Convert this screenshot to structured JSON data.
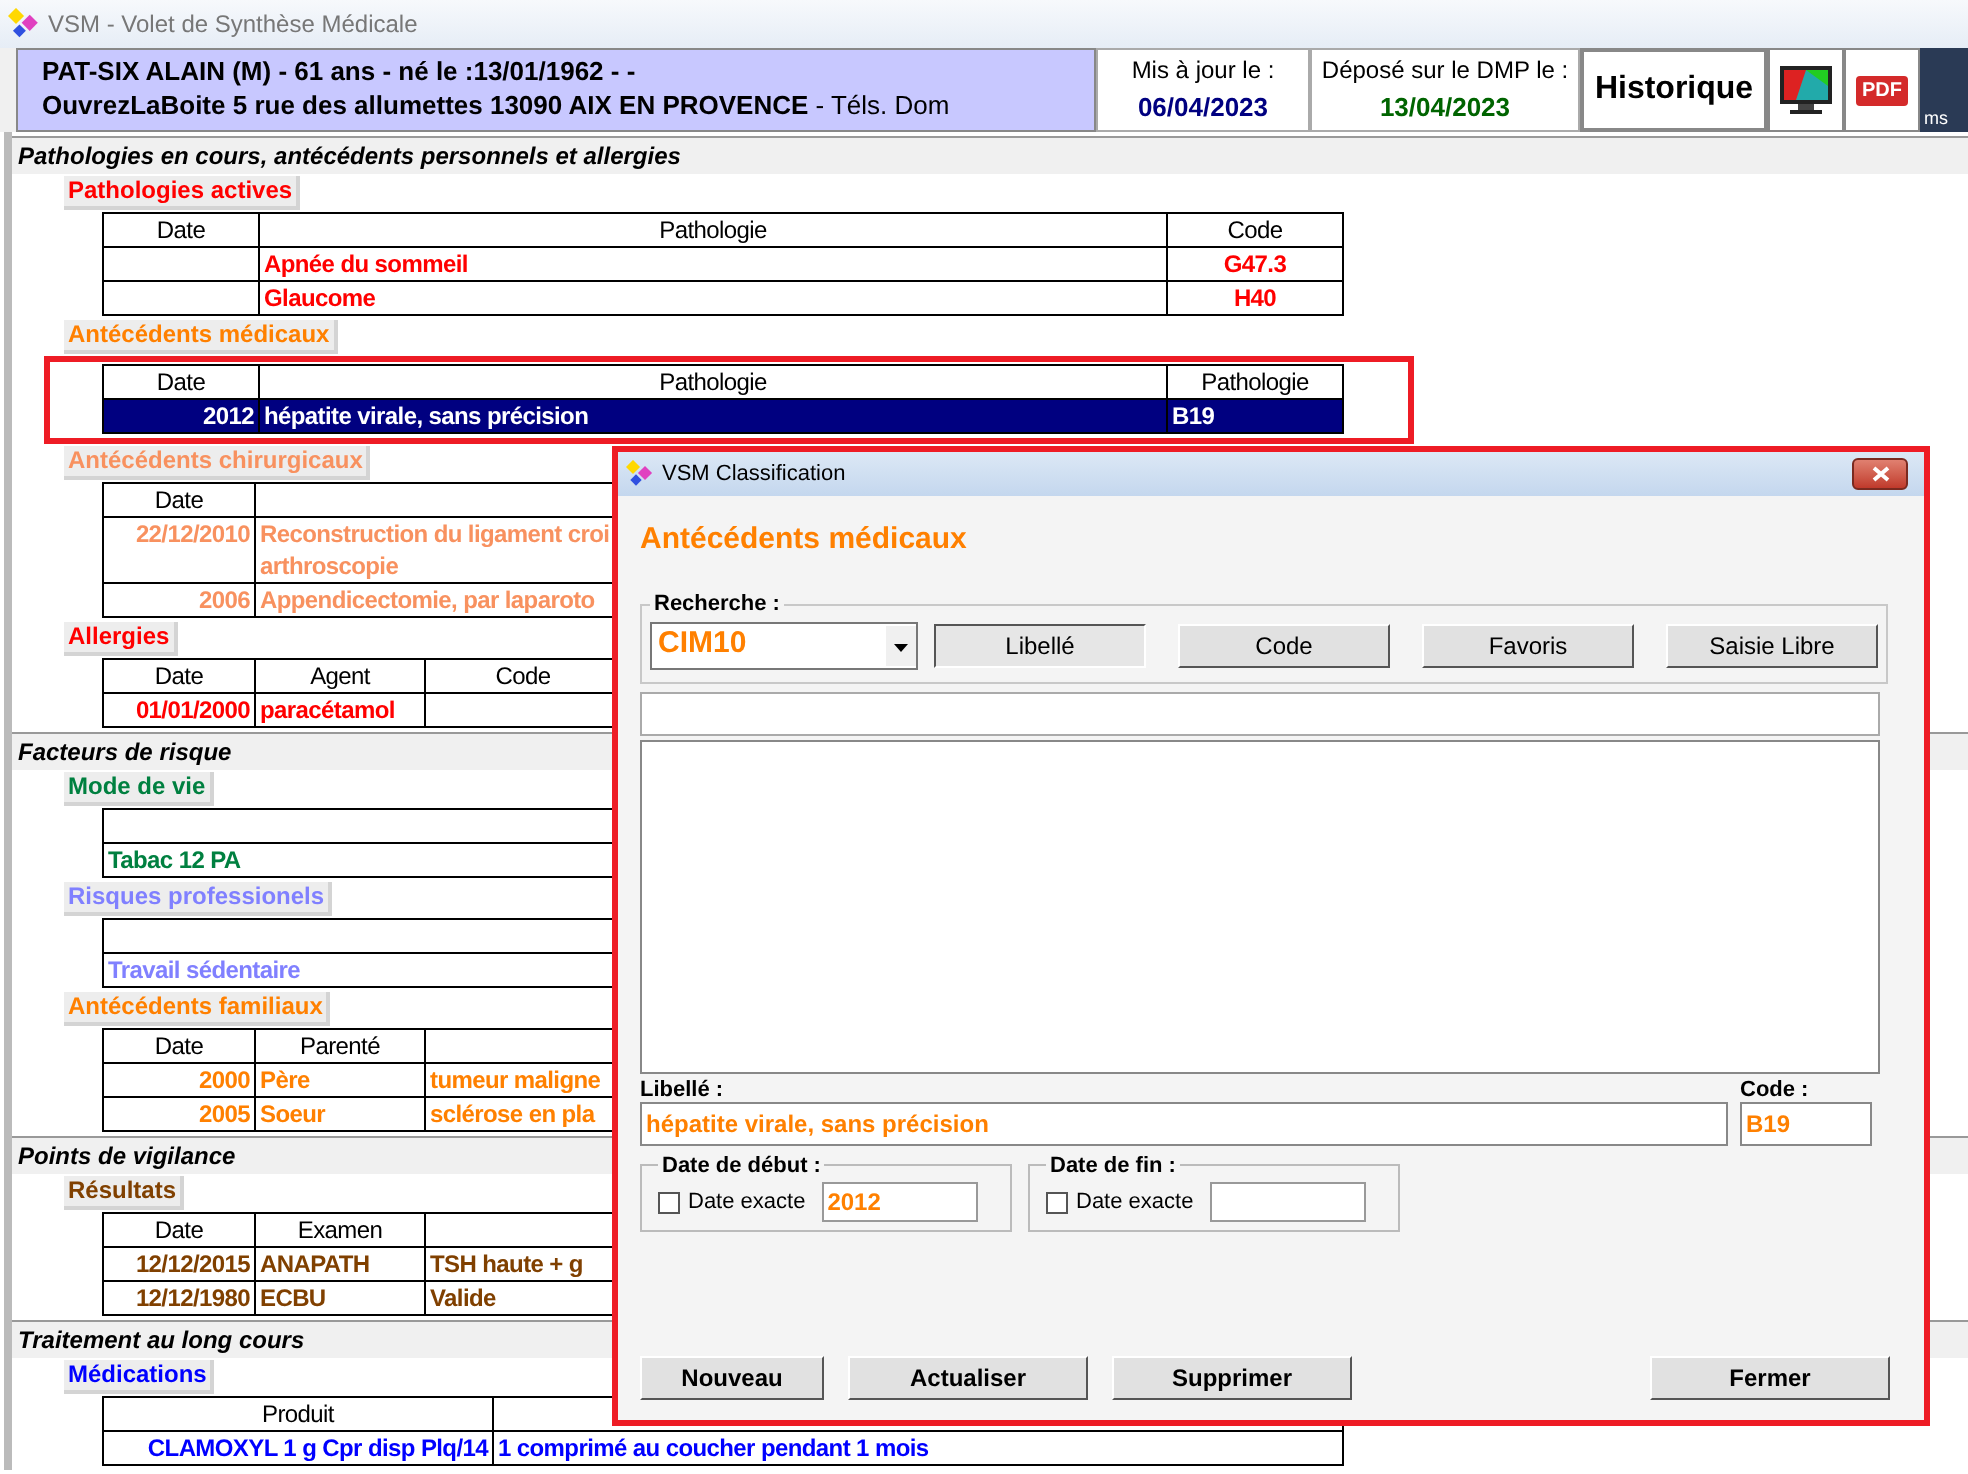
{
  "window": {
    "title": "VSM - Volet de Synthèse Médicale"
  },
  "patient": {
    "lines": [
      "PAT-SIX ALAIN (M) -  61 ans - né le :13/01/1962 - -",
      "**OuvrezLaBoite 5 rue des allumettes 13090 AIX EN PROVENCE** - Téls. Dom"
    ]
  },
  "update": {
    "label": "Mis à jour le :",
    "date": "06/04/2023"
  },
  "dmp": {
    "label": "Déposé sur le DMP le :",
    "date": "13/04/2023"
  },
  "history_button": "Historique",
  "pdf_label": "PDF",
  "edge_icon_label": "ms",
  "groups": [
    {
      "title": "Pathologies en cours, antécédents personnels et allergies",
      "sections": [
        {
          "label": "Pathologies actives",
          "color": "#ff0000",
          "kind": "full",
          "highlighted": false,
          "columns": [
            "Date",
            "Pathologie",
            "Code"
          ],
          "rows": [
            {
              "cells": [
                null,
                "Apnée du sommeil",
                "G47.3"
              ],
              "selected": false
            },
            {
              "cells": [
                null,
                "Glaucome",
                "H40"
              ],
              "selected": false
            }
          ]
        },
        {
          "label": "Antécédents médicaux",
          "color": "#ff8000",
          "kind": "full",
          "highlighted": true,
          "columns": [
            "Date",
            "Pathologie",
            "Pathologie"
          ],
          "rows": [
            {
              "cells": [
                "2012",
                "hépatite virale, sans précision",
                "B19"
              ],
              "selected": true
            }
          ]
        },
        {
          "label": "Antécédents chirurgicaux",
          "color": "#f8915f",
          "kind": "clipped",
          "highlighted": false,
          "columns": [
            "Date"
          ],
          "rows": [
            {
              "cells": [
                "22/12/2010",
                [
                  "Reconstruction du ligament croi",
                  "arthroscopie"
                ]
              ],
              "selected": false
            },
            {
              "cells": [
                "2006",
                "Appendicectomie, par laparoto"
              ],
              "selected": false
            }
          ]
        },
        {
          "label": "Allergies",
          "color": "#ff0000",
          "kind": "clipped",
          "highlighted": false,
          "columns": [
            "Date",
            "Agent",
            "Code"
          ],
          "rows": [
            {
              "cells": [
                "01/01/2000",
                "paracétamol",
                null
              ],
              "selected": false
            }
          ]
        }
      ]
    },
    {
      "title": "Facteurs de risque",
      "sections": [
        {
          "label": "Mode de vie",
          "color": "#008040",
          "kind": "clipped",
          "highlighted": false,
          "rows": [
            {
              "cells": [
                "Tabac 12 PA"
              ],
              "selected": false
            }
          ]
        },
        {
          "label": "Risques professionels",
          "color": "#8080ff",
          "kind": "clipped",
          "highlighted": false,
          "rows": [
            {
              "cells": [
                "Travail sédentaire"
              ],
              "selected": false
            }
          ]
        },
        {
          "label": "Antécédents familiaux",
          "color": "#ff8000",
          "kind": "clipped",
          "highlighted": false,
          "columns": [
            "Date",
            "Parenté"
          ],
          "rows": [
            {
              "cells": [
                "2000",
                "Père",
                "tumeur maligne"
              ],
              "selected": false
            },
            {
              "cells": [
                "2005",
                "Soeur",
                "sclérose en pla"
              ],
              "selected": false
            }
          ]
        }
      ]
    },
    {
      "title": "Points de vigilance",
      "sections": [
        {
          "label": "Résultats",
          "color": "#804000",
          "kind": "clipped",
          "highlighted": false,
          "columns": [
            "Date",
            "Examen"
          ],
          "rows": [
            {
              "cells": [
                "12/12/2015",
                "ANAPATH",
                " TSH haute + g"
              ],
              "selected": false
            },
            {
              "cells": [
                "12/12/1980",
                "ECBU",
                "Valide"
              ],
              "selected": false
            }
          ]
        }
      ]
    },
    {
      "title": "Traitement au long cours",
      "sections": [
        {
          "label": "Médications",
          "color": "#0000ff",
          "kind": "full",
          "highlighted": false,
          "columns": [
            "Produit"
          ],
          "rows": [
            {
              "cells": [
                "CLAMOXYL 1 g Cpr disp Plq/14",
                "1 comprimé au coucher  pendant 1 mois"
              ],
              "selected": false
            }
          ]
        }
      ]
    }
  ],
  "dialog": {
    "title": "VSM Classification",
    "highlighted": true,
    "heading": "Antécédents médicaux",
    "search": {
      "legend": "Recherche :",
      "classification": "CIM10",
      "modes": [
        {
          "label": "Libellé",
          "selected": true
        },
        {
          "label": "Code",
          "selected": false
        },
        {
          "label": "Favoris",
          "selected": false
        },
        {
          "label": "Saisie Libre",
          "selected": false
        }
      ]
    },
    "label_field": {
      "label": "Libellé :",
      "value": "hépatite virale, sans précision"
    },
    "code_field": {
      "label": "Code :",
      "value": "B19"
    },
    "start_date": {
      "legend": "Date de début :",
      "checkbox": {
        "label": "Date exacte",
        "checked": false
      },
      "value": "2012"
    },
    "end_date": {
      "legend": "Date de fin :",
      "checkbox": {
        "label": "Date exacte",
        "checked": false
      }
    },
    "buttons": [
      "Nouveau",
      "Actualiser",
      "Supprimer"
    ],
    "close_button": "Fermer"
  }
}
